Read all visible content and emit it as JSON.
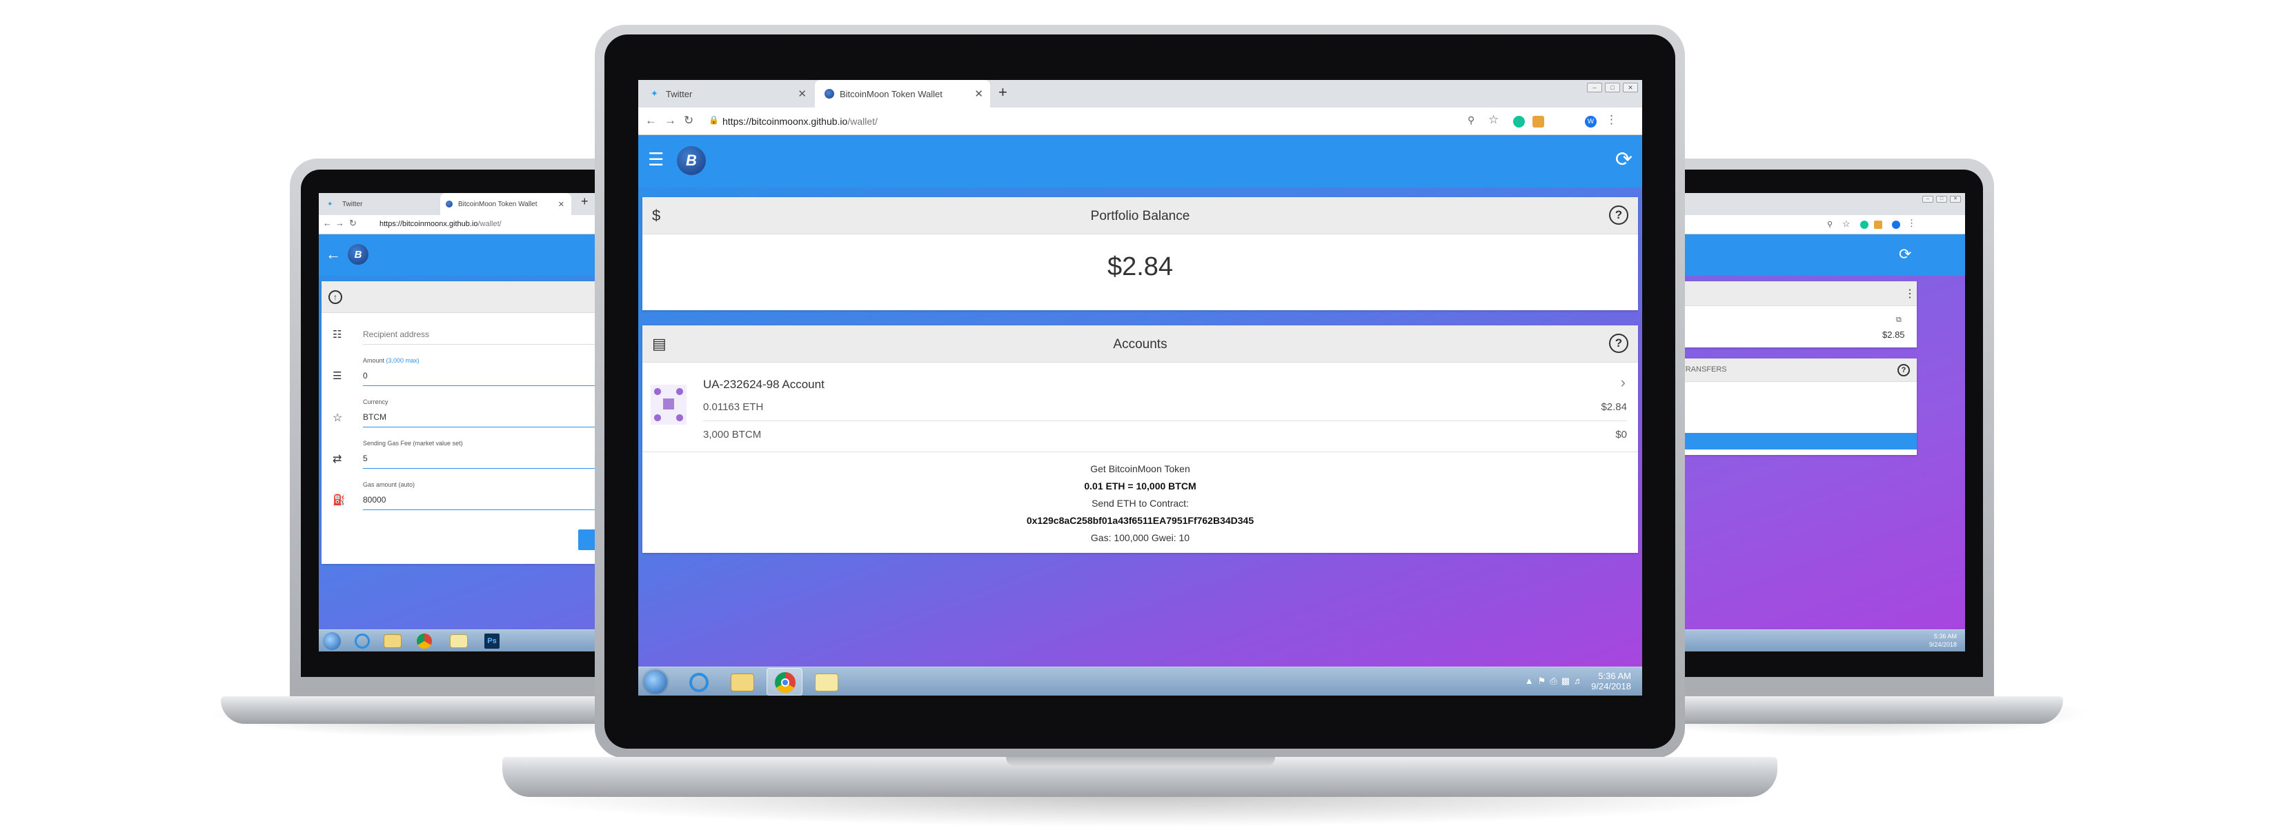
{
  "browser": {
    "tabs": [
      {
        "label": "Twitter"
      },
      {
        "label": "BitcoinMoon Token Wallet"
      }
    ],
    "url_domain": "https://bitcoinmoonx.github.io",
    "url_path": "/wallet/",
    "profile_initial": "W"
  },
  "app": {
    "brand_letter": "B",
    "accent_color": "#2c93ee",
    "gradient_end_color": "#a746df"
  },
  "portfolio": {
    "title": "Portfolio Balance",
    "balance": "$2.84",
    "help": "?"
  },
  "accounts": {
    "title": "Accounts",
    "help": "?",
    "items": [
      {
        "name": "UA-232624-98 Account",
        "eth_amount": "0.01163 ETH",
        "eth_value": "$2.84",
        "token_amount": "3,000 BTCM",
        "token_value": "$0"
      }
    ]
  },
  "offer": {
    "line1": "Get BitcoinMoon Token",
    "line2": "0.01 ETH = 10,000 BTCM",
    "line3": "Send ETH to Contract:",
    "line4": "0x129c8aC258bf01a43f6511EA7951Ff762B34D345",
    "line5": "Gas: 100,000 Gwei: 10"
  },
  "send_form": {
    "recipient_placeholder": "Recipient address",
    "amount_label": "Amount",
    "amount_max": "(3,000 max)",
    "amount_value": "0",
    "currency_label": "Currency",
    "currency_value": "BTCM",
    "gas_fee_label": "Sending Gas Fee (market value set)",
    "gas_fee_value": "5",
    "gas_amount_label": "Gas amount (auto)",
    "gas_amount_value": "80000"
  },
  "right_screen": {
    "value": "$2.85",
    "tab_label": "TRANSFERS",
    "help": "?"
  },
  "taskbar": {
    "time": "5:36 AM",
    "date": "9/24/2018",
    "time_small": "5:36 AM",
    "date_small": "9/24/2018",
    "ps_label": "Ps"
  }
}
